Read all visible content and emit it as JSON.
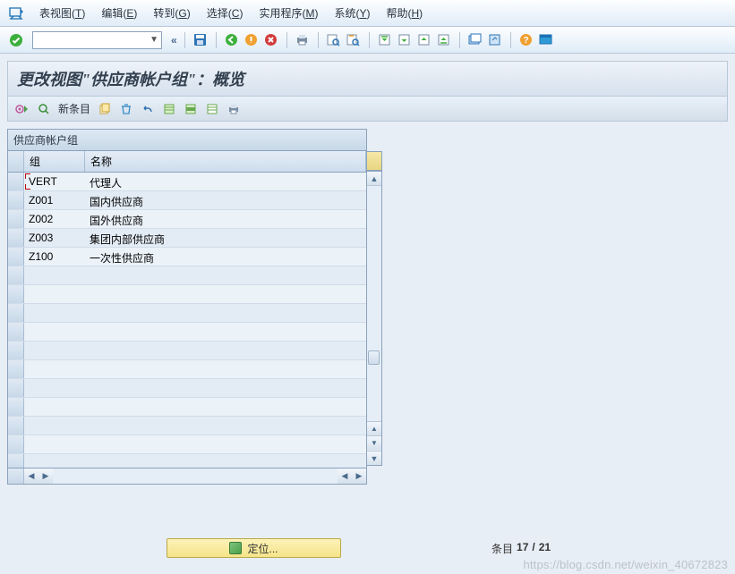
{
  "menubar": {
    "items": [
      {
        "label": "表视图",
        "key": "T"
      },
      {
        "label": "编辑",
        "key": "E"
      },
      {
        "label": "转到",
        "key": "G"
      },
      {
        "label": "选择",
        "key": "C"
      },
      {
        "label": "实用程序",
        "key": "M"
      },
      {
        "label": "系统",
        "key": "Y"
      },
      {
        "label": "帮助",
        "key": "H"
      }
    ]
  },
  "title": "更改视图\"供应商帐户组\"：概览",
  "subtoolbar": {
    "new_entry": "新条目"
  },
  "panel": {
    "title": "供应商帐户组",
    "columns": {
      "code": "组",
      "name": "名称"
    },
    "rows": [
      {
        "code": "VERT",
        "name": "代理人"
      },
      {
        "code": "Z001",
        "name": "国内供应商"
      },
      {
        "code": "Z002",
        "name": "国外供应商"
      },
      {
        "code": "Z003",
        "name": "集团内部供应商"
      },
      {
        "code": "Z100",
        "name": "一次性供应商"
      }
    ],
    "empty_rows": 11
  },
  "footer": {
    "locate": "定位...",
    "entry_label": "条目",
    "entry_current": "17",
    "entry_sep": "/",
    "entry_total": "21"
  },
  "watermark": "https://blog.csdn.net/weixin_40672823"
}
